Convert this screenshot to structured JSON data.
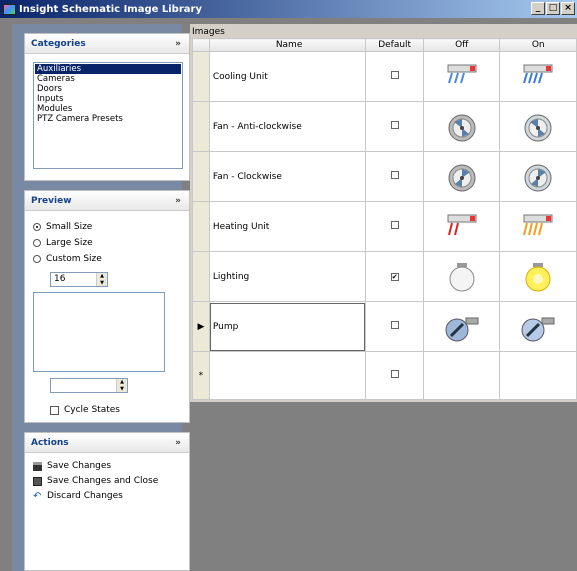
{
  "window": {
    "title": "Insight Schematic Image Library",
    "minimize": "_",
    "maximize": "□",
    "close": "×"
  },
  "categories": {
    "header": "Categories",
    "collapse": "»",
    "items": [
      "Auxiliaries",
      "Cameras",
      "Doors",
      "Inputs",
      "Modules",
      "PTZ Camera Presets"
    ],
    "selected_index": 0
  },
  "preview": {
    "header": "Preview",
    "collapse": "»",
    "options": [
      "Small Size",
      "Large Size",
      "Custom Size"
    ],
    "selected_option": 0,
    "custom_size_value": "16",
    "state_value": "",
    "cycle_states_label": "Cycle States",
    "cycle_states_checked": false
  },
  "actions": {
    "header": "Actions",
    "collapse": "»",
    "items": [
      {
        "label": "Save Changes",
        "icon": "save-icon"
      },
      {
        "label": "Save Changes and Close",
        "icon": "save-close-icon"
      },
      {
        "label": "Discard Changes",
        "icon": "undo-icon"
      }
    ]
  },
  "images": {
    "label": "Images",
    "columns": [
      "Name",
      "Default",
      "Off",
      "On"
    ],
    "rows": [
      {
        "name": "Cooling Unit",
        "default": false,
        "off_icon": "cooling-unit-off-icon",
        "on_icon": "cooling-unit-on-icon"
      },
      {
        "name": "Fan - Anti-clockwise",
        "default": false,
        "off_icon": "fan-anticlockwise-off-icon",
        "on_icon": "fan-anticlockwise-on-icon"
      },
      {
        "name": "Fan - Clockwise",
        "default": false,
        "off_icon": "fan-clockwise-off-icon",
        "on_icon": "fan-clockwise-on-icon"
      },
      {
        "name": "Heating Unit",
        "default": false,
        "off_icon": "heating-unit-off-icon",
        "on_icon": "heating-unit-on-icon"
      },
      {
        "name": "Lighting",
        "default": true,
        "off_icon": "light-off-icon",
        "on_icon": "light-on-icon"
      },
      {
        "name": "Pump",
        "default": false,
        "off_icon": "pump-off-icon",
        "on_icon": "pump-on-icon"
      }
    ],
    "current_row": 5,
    "new_row_marker": "*",
    "current_row_marker": "▶",
    "check_mark": "✔"
  }
}
